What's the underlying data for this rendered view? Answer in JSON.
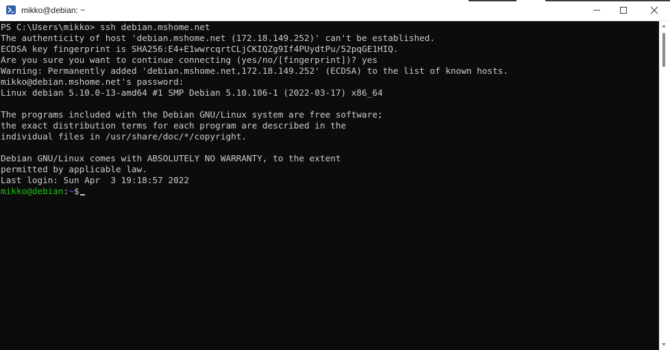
{
  "window": {
    "title": "mikko@debian: ~",
    "icon": "powershell-icon",
    "controls": {
      "minimize_icon": "minimize-icon",
      "maximize_icon": "maximize-icon",
      "close_icon": "close-icon"
    }
  },
  "colors": {
    "background": "#0c0c0c",
    "foreground": "#cccccc",
    "prompt_user": "#16c60c",
    "prompt_path": "#3b78ff",
    "titlebar": "#ffffff"
  },
  "terminal": {
    "lines": [
      "PS C:\\Users\\mikko> ssh debian.mshome.net",
      "The authenticity of host 'debian.mshome.net (172.18.149.252)' can't be established.",
      "ECDSA key fingerprint is SHA256:E4+E1wwrcqrtCLjCKIQZg9If4PUydtPu/52pqGE1HIQ.",
      "Are you sure you want to continue connecting (yes/no/[fingerprint])? yes",
      "Warning: Permanently added 'debian.mshome.net,172.18.149.252' (ECDSA) to the list of known hosts.",
      "mikko@debian.mshome.net's password:",
      "Linux debian 5.10.0-13-amd64 #1 SMP Debian 5.10.106-1 (2022-03-17) x86_64",
      "",
      "The programs included with the Debian GNU/Linux system are free software;",
      "the exact distribution terms for each program are described in the",
      "individual files in /usr/share/doc/*/copyright.",
      "",
      "Debian GNU/Linux comes with ABSOLUTELY NO WARRANTY, to the extent",
      "permitted by applicable law.",
      "Last login: Sun Apr  3 19:18:57 2022"
    ],
    "prompt": {
      "user_host": "mikko@debian",
      "separator": ":",
      "path": "~",
      "symbol": "$"
    }
  }
}
